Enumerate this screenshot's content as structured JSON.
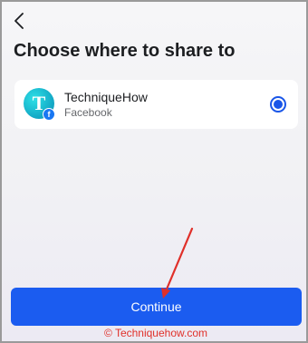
{
  "header": {
    "back_icon": "chevron-left-icon",
    "title": "Choose where to share to"
  },
  "account": {
    "avatar_letter": "T",
    "name": "TechniqueHow",
    "platform": "Facebook",
    "platform_icon": "facebook-icon",
    "selected": true
  },
  "footer": {
    "continue_label": "Continue",
    "watermark": "© Techniquehow.com"
  },
  "colors": {
    "accent": "#1b5cf0",
    "annotation_arrow": "#e0302a",
    "facebook": "#1877f2"
  }
}
